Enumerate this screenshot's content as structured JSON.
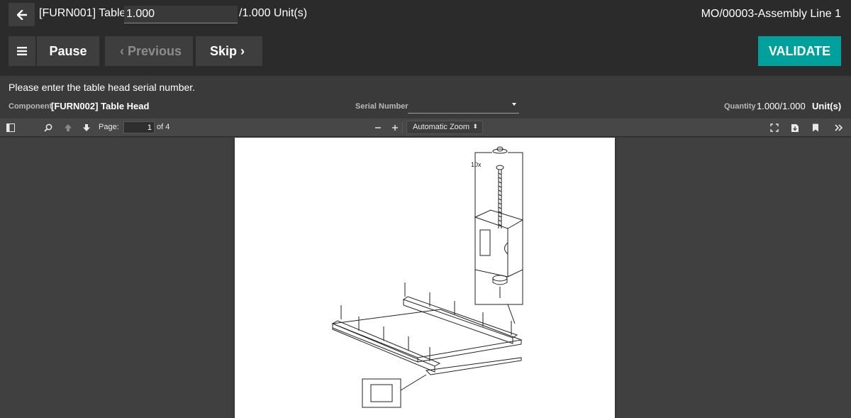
{
  "header": {
    "back_icon": "arrow-left-icon",
    "title_prefix": "[FURN001] Table:",
    "qty_value": "1.000",
    "qty_suffix": "/1.000 Unit(s)",
    "mo_title": "MO/00003-Assembly Line 1"
  },
  "controls": {
    "menu_icon": "hamburger-menu-icon",
    "pause_label": "Pause",
    "previous_label": "Previous",
    "skip_label": "Skip",
    "validate_label": "VALIDATE",
    "validate_color": "#00a09d"
  },
  "step": {
    "instruction": "Please enter the table head serial number.",
    "component_label": "Component",
    "component_value": "[FURN002] Table Head",
    "serial_label": "Serial Number",
    "serial_value": "",
    "quantity_label": "Quantity",
    "quantity_value": "1.000/1.000",
    "quantity_unit": "Unit(s)"
  },
  "pdf_toolbar": {
    "page_label": "Page:",
    "page_current": "1",
    "page_total": "of 4",
    "zoom_value": "Automatic Zoom"
  },
  "pdf_page": {
    "callout_text": "10x"
  }
}
